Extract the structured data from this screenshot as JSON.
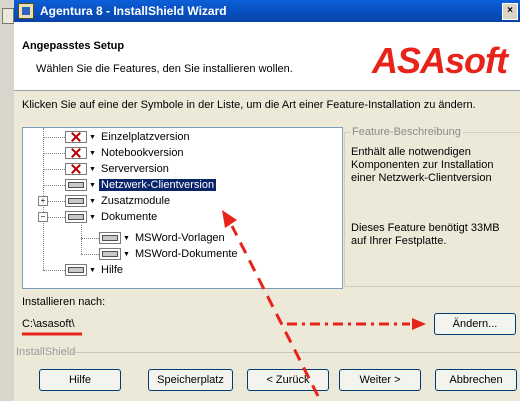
{
  "window": {
    "title": "Agentura 8 - InstallShield Wizard",
    "close_glyph": "×"
  },
  "header": {
    "title": "Angepasstes Setup",
    "subtitle": "Wählen Sie die Features, den Sie installieren wollen.",
    "logo_text": "ASAsoft"
  },
  "instruction": "Klicken Sie auf eine der Symbole in der Liste, um die Art einer Feature-Installation zu ändern.",
  "features": [
    {
      "label": "Einzelplatzversion",
      "icon": "x-icon"
    },
    {
      "label": "Notebookversion",
      "icon": "x-icon"
    },
    {
      "label": "Serverversion",
      "icon": "x-icon"
    },
    {
      "label": "Netzwerk-Clientversion",
      "icon": "drive-icon",
      "selected": true
    },
    {
      "label": "Zusatzmodule",
      "icon": "drive-icon"
    },
    {
      "label": "Dokumente",
      "icon": "drive-icon"
    },
    {
      "label": "MSWord-Vorlagen",
      "icon": "drive-icon"
    },
    {
      "label": "MSWord-Dokumente",
      "icon": "drive-icon"
    },
    {
      "label": "Hilfe",
      "icon": "drive-icon"
    }
  ],
  "expanders": {
    "collapsed": "+",
    "expanded": "−"
  },
  "description": {
    "legend": "Feature-Beschreibung",
    "text": "Enthält alle notwendigen Komponenten zur Installation einer Netzwerk-Clientversion",
    "space": "Dieses Feature benötigt 33MB auf Ihrer Festplatte."
  },
  "install_to": {
    "label": "Installieren nach:",
    "path": "C:\\asasoft\\"
  },
  "buttons": {
    "change": "Ändern...",
    "help": "Hilfe",
    "space": "Speicherplatz",
    "back": "< Zurück",
    "next": "Weiter >",
    "cancel": "Abbrechen"
  },
  "installshield_label": "InstallShield",
  "colors": {
    "annotation": "#e8231a",
    "selection": "#0a246a",
    "title_bar": "#0a5fd8"
  }
}
